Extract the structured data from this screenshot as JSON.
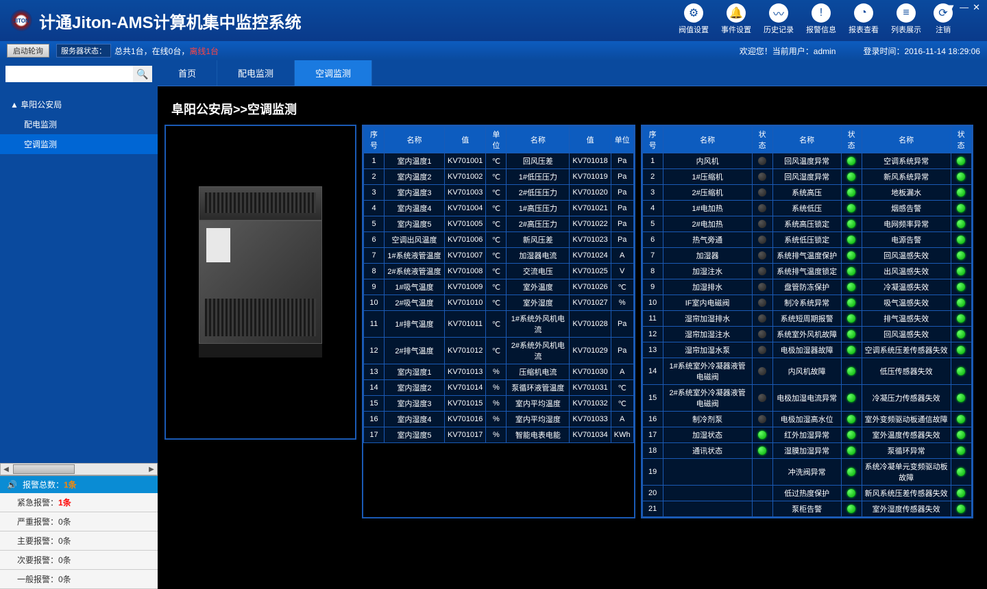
{
  "app": {
    "title": "计通Jiton-AMS计算机集中监控系统",
    "logo_text": "JITON"
  },
  "tools": [
    {
      "icon": "⚙",
      "label": "阀值设置"
    },
    {
      "icon": "🔔",
      "label": "事件设置"
    },
    {
      "icon": "〰",
      "label": "历史记录"
    },
    {
      "icon": "!",
      "label": "报警信息"
    },
    {
      "icon": "◔",
      "label": "报表查看"
    },
    {
      "icon": "≡",
      "label": "列表展示"
    },
    {
      "icon": "⟳",
      "label": "注销"
    }
  ],
  "window": {
    "help": "?",
    "down": "▼",
    "min": "—",
    "close": "✕"
  },
  "status": {
    "poll_btn": "启动轮询",
    "server_label": "服务器状态：",
    "server_text": "总共1台，在线0台，",
    "server_offline": "离线1台",
    "welcome": "欢迎您！当前用户：admin",
    "login_time": "登录时间：2016-11-14 18:29:06"
  },
  "search": {
    "placeholder": ""
  },
  "tree": {
    "root": "▲ 阜阳公安局",
    "c1": "配电监测",
    "c2": "空调监测"
  },
  "alarms": {
    "header_label": "报警总数：",
    "header_count": "1条",
    "r1_label": "紧急报警：",
    "r1_count": "1条",
    "r2": "严重报警：0条",
    "r3": "主要报警：0条",
    "r4": "次要报警：0条",
    "r5": "一般报警：0条"
  },
  "tabs": [
    "首页",
    "配电监测",
    "空调监测"
  ],
  "breadcrumb": "阜阳公安局>>空调监测",
  "tbl1": {
    "headers": [
      "序号",
      "名称",
      "值",
      "单位",
      "名称",
      "值",
      "单位"
    ],
    "rows": [
      [
        "1",
        "室内温度1",
        "KV701001",
        "℃",
        "回风压差",
        "KV701018",
        "Pa"
      ],
      [
        "2",
        "室内温度2",
        "KV701002",
        "℃",
        "1#低压压力",
        "KV701019",
        "Pa"
      ],
      [
        "3",
        "室内温度3",
        "KV701003",
        "℃",
        "2#低压压力",
        "KV701020",
        "Pa"
      ],
      [
        "4",
        "室内温度4",
        "KV701004",
        "℃",
        "1#高压压力",
        "KV701021",
        "Pa"
      ],
      [
        "5",
        "室内温度5",
        "KV701005",
        "℃",
        "2#高压压力",
        "KV701022",
        "Pa"
      ],
      [
        "6",
        "空调出风温度",
        "KV701006",
        "℃",
        "新风压差",
        "KV701023",
        "Pa"
      ],
      [
        "7",
        "1#系统液管温度",
        "KV701007",
        "℃",
        "加湿器电流",
        "KV701024",
        "A"
      ],
      [
        "8",
        "2#系统液管温度",
        "KV701008",
        "℃",
        "交流电压",
        "KV701025",
        "V"
      ],
      [
        "9",
        "1#吸气温度",
        "KV701009",
        "℃",
        "室外温度",
        "KV701026",
        "℃"
      ],
      [
        "10",
        "2#吸气温度",
        "KV701010",
        "℃",
        "室外湿度",
        "KV701027",
        "%"
      ],
      [
        "11",
        "1#排气温度",
        "KV701011",
        "℃",
        "1#系统外风机电流",
        "KV701028",
        "Pa"
      ],
      [
        "12",
        "2#排气温度",
        "KV701012",
        "℃",
        "2#系统外风机电流",
        "KV701029",
        "Pa"
      ],
      [
        "13",
        "室内湿度1",
        "KV701013",
        "%",
        "压缩机电流",
        "KV701030",
        "A"
      ],
      [
        "14",
        "室内湿度2",
        "KV701014",
        "%",
        "泵循环液管温度",
        "KV701031",
        "℃"
      ],
      [
        "15",
        "室内湿度3",
        "KV701015",
        "%",
        "室内平均温度",
        "KV701032",
        "℃"
      ],
      [
        "16",
        "室内湿度4",
        "KV701016",
        "%",
        "室内平均湿度",
        "KV701033",
        "A"
      ],
      [
        "17",
        "室内湿度5",
        "KV701017",
        "%",
        "智能电表电能",
        "KV701034",
        "KWh"
      ]
    ]
  },
  "tbl2": {
    "headers": [
      "序号",
      "名称",
      "状态",
      "名称",
      "状态",
      "名称",
      "状态"
    ],
    "rows": [
      [
        "1",
        "内风机",
        "dark",
        "回风温度异常",
        "green",
        "空调系统异常",
        "green"
      ],
      [
        "2",
        "1#压缩机",
        "dark",
        "回风湿度异常",
        "green",
        "新风系统异常",
        "green"
      ],
      [
        "3",
        "2#压缩机",
        "dark",
        "系统高压",
        "green",
        "地板漏水",
        "green"
      ],
      [
        "4",
        "1#电加热",
        "dark",
        "系统低压",
        "green",
        "烟感告警",
        "green"
      ],
      [
        "5",
        "2#电加热",
        "dark",
        "系统高压锁定",
        "green",
        "电网频率异常",
        "green"
      ],
      [
        "6",
        "热气旁通",
        "dark",
        "系统低压锁定",
        "green",
        "电源告警",
        "green"
      ],
      [
        "7",
        "加湿器",
        "dark",
        "系统排气温度保护",
        "green",
        "回风温感失效",
        "green"
      ],
      [
        "8",
        "加湿注水",
        "dark",
        "系统排气温度锁定",
        "green",
        "出风温感失效",
        "green"
      ],
      [
        "9",
        "加湿排水",
        "dark",
        "盘管防冻保护",
        "green",
        "冷凝温感失效",
        "green"
      ],
      [
        "10",
        "IF室内电磁阀",
        "dark",
        "制冷系统异常",
        "green",
        "吸气温感失效",
        "green"
      ],
      [
        "11",
        "湿帘加湿排水",
        "dark",
        "系统短周期报警",
        "green",
        "排气温感失效",
        "green"
      ],
      [
        "12",
        "湿帘加湿注水",
        "dark",
        "系统室外风机故障",
        "green",
        "回风温感失效",
        "green"
      ],
      [
        "13",
        "湿帘加湿水泵",
        "dark",
        "电极加湿器故障",
        "green",
        "空调系统压差传感器失效",
        "green"
      ],
      [
        "14",
        "1#系统室外冷凝器液管电磁阀",
        "dark",
        "内风机故障",
        "green",
        "低压传感器失效",
        "green"
      ],
      [
        "15",
        "2#系统室外冷凝器液管电磁阀",
        "dark",
        "电极加湿电流异常",
        "green",
        "冷凝压力传感器失效",
        "green"
      ],
      [
        "16",
        "制冷剂泵",
        "dark",
        "电极加湿高水位",
        "green",
        "室外变频驱动板通信故障",
        "green"
      ],
      [
        "17",
        "加湿状态",
        "green",
        "红外加湿异常",
        "green",
        "室外温度传感器失效",
        "green"
      ],
      [
        "18",
        "通讯状态",
        "green",
        "湿膜加湿异常",
        "green",
        "泵循环异常",
        "green"
      ],
      [
        "19",
        "",
        "",
        "冲洗阀异常",
        "green",
        "系统冷凝单元变频驱动板故障",
        "green"
      ],
      [
        "20",
        "",
        "",
        "低过热度保护",
        "green",
        "新风系统压差传感器失效",
        "green"
      ],
      [
        "21",
        "",
        "",
        "泵柜告警",
        "green",
        "室外湿度传感器失效",
        "green"
      ]
    ]
  }
}
